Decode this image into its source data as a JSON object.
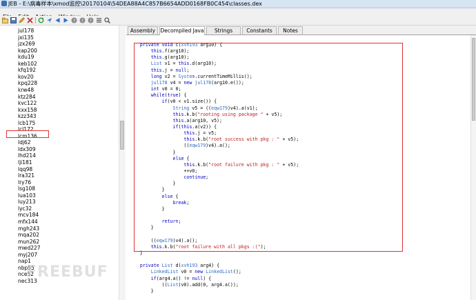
{
  "window": {
    "title": "JEB - E:\\病毒样本\\xmod监控\\20170104\\54DEA88A4C857B6654ADD0168FB0C454\\classes.dex"
  },
  "menu": [
    "File",
    "Edit",
    "Action",
    "Window",
    "Help"
  ],
  "toolbar": [
    "open-icon",
    "save-icon",
    "edit-icon",
    "delete-icon",
    "refresh-icon",
    "navigate-icon",
    "back-icon",
    "forward-icon",
    "help-icon",
    "help2-icon",
    "info-icon",
    "list-icon",
    "zoom-icon"
  ],
  "left_list": {
    "items": [
      "jul178",
      "jxi135",
      "jzx269",
      "kap200",
      "kdu19",
      "keb102",
      "kfq192",
      "kov20",
      "kpq228",
      "krw48",
      "ktz284",
      "kvc122",
      "kxx158",
      "kzz343",
      "lcb175",
      "lcl172",
      "lcm136",
      "ldj62",
      "ldx309",
      "lhd214",
      "lji181",
      "lqq98",
      "lra321",
      "lry76",
      "lsg108",
      "lua103",
      "luy213",
      "lyc32",
      "mcv184",
      "mfx144",
      "mgh243",
      "mqa202",
      "mun262",
      "mwd227",
      "myj207",
      "nap1",
      "nbp55",
      "nce52",
      "nec313"
    ],
    "selected": "lcl172"
  },
  "tabs": [
    "Assembly",
    "Decompiled Java",
    "Strings",
    "Constants",
    "Notes"
  ],
  "active_tab": "Decompiled Java",
  "code_lines": [
    "    private void c(xvh193 arg10) {",
    "        this.f(arg10);",
    "        this.g(arg10);",
    "        List v1 = this.d(arg10);",
    "        this.j = null;",
    "        long v2 = System.currentTimeMillis();",
    "        jul178 v4 = new jul178(arg10.e());",
    "        int v0 = 0;",
    "        while(true) {",
    "            if(v0 < v1.size()) {",
    "                String v5 = ((eqw179)v4).a(v1);",
    "                this.k.b(\"rooting using package \" + v5);",
    "                this.a(arg10, v5);",
    "                if(this.a(v2)) {",
    "                    this.j = v5;",
    "                    this.k.b(\"root success with pkg : \" + v5);",
    "                    ((eqw179)v4).a();",
    "                }",
    "                else {",
    "                    this.k.b(\"root failure with pkg : \" + v5);",
    "                    ++v0;",
    "                    continue;",
    "                }",
    "            }",
    "            else {",
    "                break;",
    "            }",
    "",
    "            return;",
    "        }",
    "",
    "        ((eqw179)v4).a();",
    "        this.k.b(\"root failure with all pkgs :(\");",
    "    }",
    "",
    "    private List d(xvh193 arg4) {",
    "        LinkedList v0 = new LinkedList();",
    "        if(arg4.a() != null) {",
    "            ((List)v0).add(0, arg4.a());",
    "        }"
  ],
  "watermark": "FREEBUF",
  "colors": {
    "keyword": "#0000c0",
    "type": "#2b6bc4",
    "string": "#c02020",
    "highlight_border": "#e03030"
  }
}
